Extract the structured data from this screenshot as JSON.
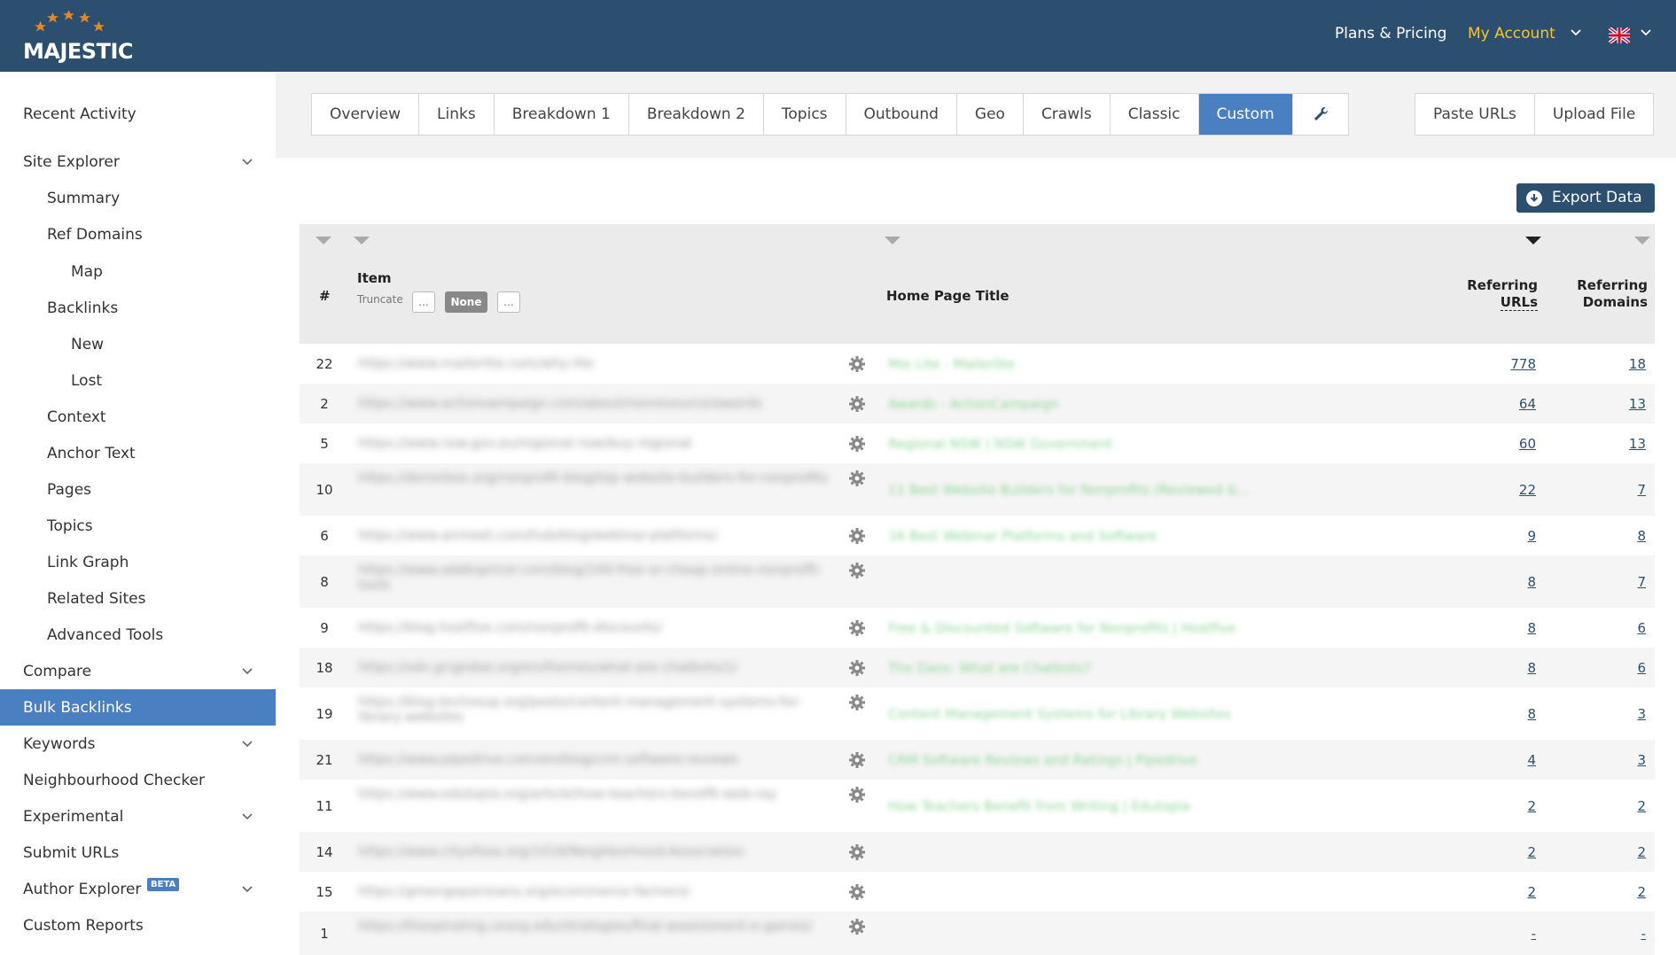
{
  "header": {
    "logo_text": "MAJESTIC",
    "plans_label": "Plans & Pricing",
    "account_label": "My Account",
    "colors": {
      "bar": "#2c4f6f",
      "account": "#f4c430"
    }
  },
  "sidebar": {
    "items": [
      {
        "label": "Recent Activity"
      },
      {
        "label": "Site Explorer"
      },
      {
        "label": "Summary"
      },
      {
        "label": "Ref Domains"
      },
      {
        "label": "Map"
      },
      {
        "label": "Backlinks"
      },
      {
        "label": "New"
      },
      {
        "label": "Lost"
      },
      {
        "label": "Context"
      },
      {
        "label": "Anchor Text"
      },
      {
        "label": "Pages"
      },
      {
        "label": "Topics"
      },
      {
        "label": "Link Graph"
      },
      {
        "label": "Related Sites"
      },
      {
        "label": "Advanced Tools"
      },
      {
        "label": "Compare"
      },
      {
        "label": "Bulk Backlinks"
      },
      {
        "label": "Keywords"
      },
      {
        "label": "Neighbourhood Checker"
      },
      {
        "label": "Experimental"
      },
      {
        "label": "Submit URLs"
      },
      {
        "label": "Author Explorer",
        "badge": "BETA"
      },
      {
        "label": "Custom Reports"
      }
    ]
  },
  "tabs": {
    "items": [
      "Overview",
      "Links",
      "Breakdown 1",
      "Breakdown 2",
      "Topics",
      "Outbound",
      "Geo",
      "Crawls",
      "Classic",
      "Custom"
    ],
    "active": "Custom",
    "right": [
      "Paste URLs",
      "Upload File"
    ]
  },
  "export_label": "Export Data",
  "table": {
    "col_num": "#",
    "col_item": "Item",
    "truncate_label": "Truncate",
    "trunc_b1": "...",
    "trunc_b2": "None",
    "trunc_b3": "...",
    "col_title": "Home Page Title",
    "col_urls_1": "Referring",
    "col_urls_2": "URLs",
    "col_dom_1": "Referring",
    "col_dom_2": "Domains",
    "rows": [
      {
        "num": "22",
        "item": "https://www.mailerlite.com/why-lite",
        "title": "Mio Lite - Mailerlite",
        "urls": "778",
        "domains": "18"
      },
      {
        "num": "2",
        "item": "https://www.actionsampaign.com/about/nonresource/awards",
        "title": "Awards - ActionCampaign",
        "urls": "64",
        "domains": "13"
      },
      {
        "num": "5",
        "item": "https://www.nsw.gov.au/regional-nsw/buy-regional",
        "title": "Regional NSW | NSW Government",
        "urls": "60",
        "domains": "13"
      },
      {
        "num": "10",
        "item": "https://donorbox.org/nonprofit-blog/top-website-builders-for-nonprofits",
        "title": "11 Best Website Builders for Nonprofits (Reviewed &...",
        "urls": "22",
        "domains": "7"
      },
      {
        "num": "6",
        "item": "https://www.airmeet.com/hub/blog/webinar-platforms/",
        "title": "16 Best Webinar Platforms and Software",
        "urls": "9",
        "domains": "8"
      },
      {
        "num": "8",
        "item": "https://www.addtopricer.com/blog/100-free-or-cheap-online-nonprofit-tools",
        "title": "",
        "urls": "8",
        "domains": "7"
      },
      {
        "num": "9",
        "item": "https://blog.hostfive.com/nonprofit-discounts/",
        "title": "Free & Discounted Software for Nonprofits | Hostfive",
        "urls": "8",
        "domains": "6"
      },
      {
        "num": "18",
        "item": "https://sdn.gr/global.org/en/themes/what-are-chatbots/1/",
        "title": "The Daos: What are Chatbots?",
        "urls": "8",
        "domains": "6"
      },
      {
        "num": "19",
        "item": "https://blog.techsoup.org/posts/content-management-systems-for-library-websites",
        "title": "Content Management Systems for Library Websites",
        "urls": "8",
        "domains": "3"
      },
      {
        "num": "21",
        "item": "https://www.pipedrive.com/en/blog/crm-software-reviews",
        "title": "CRM Software Reviews and Ratings | Pipedrive",
        "urls": "4",
        "domains": "3"
      },
      {
        "num": "11",
        "item": "https://www.edutopia.org/article/how-teachers-benefit-web-ray",
        "title": "How Teachers Benefit from Writing | Edutopia",
        "urls": "2",
        "domains": "2"
      },
      {
        "num": "14",
        "item": "https://www.cityofsea.org/1016/Neighborhood-Association",
        "title": "",
        "urls": "2",
        "domains": "2"
      },
      {
        "num": "15",
        "item": "https://greengoparisians.org/ecommerce-farmers/",
        "title": "",
        "urls": "2",
        "domains": "2"
      },
      {
        "num": "1",
        "item": "https://thespiralrng.unorg.edu/strategies/final-assessment-e-games/",
        "title": "",
        "urls": "-",
        "domains": "-"
      }
    ]
  }
}
